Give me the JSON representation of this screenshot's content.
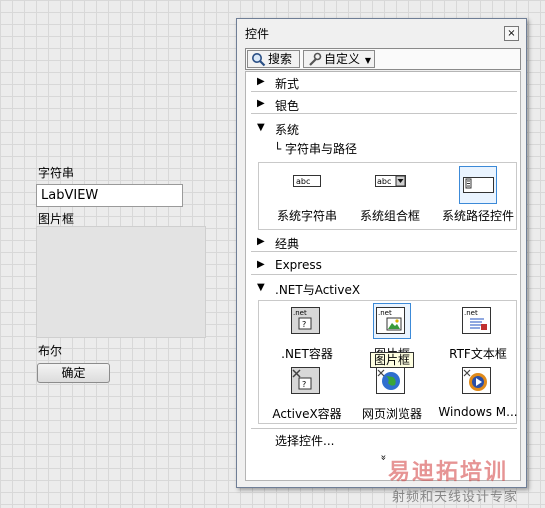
{
  "front_panel": {
    "string_label": "字符串",
    "string_value": "LabVIEW",
    "picture_label": "图片框",
    "boolean_label": "布尔",
    "button_label": "确定"
  },
  "palette": {
    "title": "控件",
    "close_glyph": "×",
    "search_label": "搜索",
    "customize_label": "自定义",
    "categories": [
      {
        "label": "新式",
        "expanded": false
      },
      {
        "label": "银色",
        "expanded": false
      },
      {
        "label": "系统",
        "expanded": true
      },
      {
        "label": "经典",
        "expanded": false
      },
      {
        "label": "Express",
        "expanded": false
      },
      {
        "label": ".NET与ActiveX",
        "expanded": true
      }
    ],
    "system_subpath": "字符串与路径",
    "system_items": [
      {
        "label": "系统字符串",
        "icon": "abc"
      },
      {
        "label": "系统组合框",
        "icon": "abc"
      },
      {
        "label": "系统路径控件",
        "icon": "path"
      }
    ],
    "net_items": [
      {
        "label": ".NET容器",
        "icon": ".net"
      },
      {
        "label": "图片框",
        "icon": ".net"
      },
      {
        "label": "RTF文本框",
        "icon": ".net"
      },
      {
        "label": "ActiveX容器",
        "icon": "activex"
      },
      {
        "label": "网页浏览器",
        "icon": "globe"
      },
      {
        "label": "Windows M...",
        "icon": "media"
      }
    ],
    "tooltip": "图片框",
    "choose_controls": "选择控件...",
    "more_glyph": "»"
  },
  "watermark": {
    "line1": "易迪拓培训",
    "line2": "射频和天线设计专家"
  },
  "colors": {
    "selection": "#3c8ad8",
    "tooltip_bg": "#ffffe1",
    "watermark_red": "#d23c3c"
  }
}
